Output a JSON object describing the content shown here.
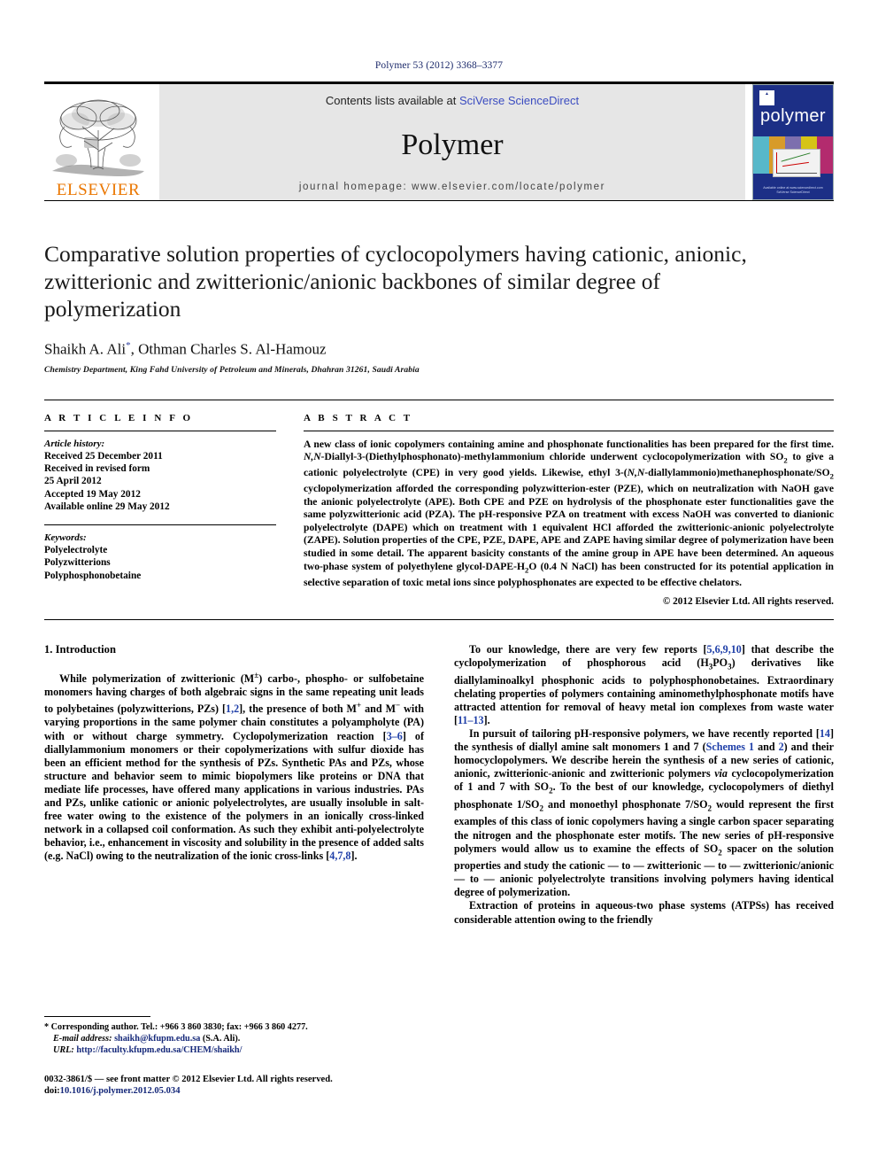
{
  "running_head": "Polymer 53 (2012) 3368–3377",
  "masthead": {
    "publisher_name": "ELSEVIER",
    "contents_prefix": "Contents lists available at ",
    "contents_link": "SciVerse ScienceDirect",
    "journal_name": "Polymer",
    "homepage": "journal homepage: www.elsevier.com/locate/polymer",
    "cover": {
      "title": "polymer",
      "footer_line1": "Available online at www.sciencedirect.com",
      "footer_line2": "SciVerse ScienceDirect"
    }
  },
  "article": {
    "title": "Comparative solution properties of cyclocopolymers having cationic, anionic, zwitterionic and zwitterionic/anionic backbones of similar degree of polymerization",
    "authors": "Shaikh A. Ali*, Othman Charles S. Al-Hamouz",
    "author_marker": "*",
    "affiliation": "Chemistry Department, King Fahd University of Petroleum and Minerals, Dhahran 31261, Saudi Arabia"
  },
  "article_info": {
    "heading": "A R T I C L E  I N F O",
    "history_label": "Article history:",
    "history": [
      "Received 25 December 2011",
      "Received in revised form",
      "25 April 2012",
      "Accepted 19 May 2012",
      "Available online 29 May 2012"
    ],
    "keywords_label": "Keywords:",
    "keywords": [
      "Polyelectrolyte",
      "Polyzwitterions",
      "Polyphosphonobetaine"
    ]
  },
  "abstract": {
    "heading": "A B S T R A C T",
    "text": "A new class of ionic copolymers containing amine and phosphonate functionalities has been prepared for the first time. N,N-Diallyl-3-(Diethylphosphonato)-methylammonium chloride underwent cyclocopolymerization with SO2 to give a cationic polyelectrolyte (CPE) in very good yields. Likewise, ethyl 3-(N,N-diallylammonio)methanephosphonate/SO2 cyclopolymerization afforded the corresponding polyzwitterion-ester (PZE), which on neutralization with NaOH gave the anionic polyelectrolyte (APE). Both CPE and PZE on hydrolysis of the phosphonate ester functionalities gave the same polyzwitterionic acid (PZA). The pH-responsive PZA on treatment with excess NaOH was converted to dianionic polyelectrolyte (DAPE) which on treatment with 1 equivalent HCl afforded the zwitterionic-anionic polyelectrolyte (ZAPE). Solution properties of the CPE, PZE, DAPE, APE and ZAPE having similar degree of polymerization have been studied in some detail. The apparent basicity constants of the amine group in APE have been determined. An aqueous two-phase system of polyethylene glycol-DAPE-H2O (0.4 N NaCl) has been constructed for its potential application in selective separation of toxic metal ions since polyphosphonates are expected to be effective chelators.",
    "copyright": "© 2012 Elsevier Ltd. All rights reserved."
  },
  "body": {
    "section_heading": "1. Introduction",
    "left_paragraphs": [
      "While polymerization of zwitterionic (M±) carbo-, phospho- or sulfobetaine monomers having charges of both algebraic signs in the same repeating unit leads to polybetaines (polyzwitterions, PZs) [1,2], the presence of both M+ and M− with varying proportions in the same polymer chain constitutes a polyampholyte (PA) with or without charge symmetry. Cyclopolymerization reaction [3–6] of diallylammonium monomers or their copolymerizations with sulfur dioxide has been an efficient method for the synthesis of PZs. Synthetic PAs and PZs, whose structure and behavior seem to mimic biopolymers like proteins or DNA that mediate life processes, have offered many applications in various industries. PAs and PZs, unlike cationic or anionic polyelectrolytes, are usually insoluble in salt-free water owing to the existence of the polymers in an ionically cross-linked network in a collapsed coil conformation. As such they exhibit anti-polyelectrolyte behavior, i.e., enhancement in viscosity and solubility in the presence of added salts (e.g. NaCl) owing to the neutralization of the ionic cross-links [4,7,8]."
    ],
    "right_paragraphs": [
      "To our knowledge, there are very few reports [5,6,9,10] that describe the cyclopolymerization of phosphorous acid (H3PO3) derivatives like diallylaminoalkyl phosphonic acids to polyphosphonobetaines. Extraordinary chelating properties of polymers containing aminomethylphosphonate motifs have attracted attention for removal of heavy metal ion complexes from waste water [11–13].",
      "In pursuit of tailoring pH-responsive polymers, we have recently reported [14] the synthesis of diallyl amine salt monomers 1 and 7 (Schemes 1 and 2) and their homocyclopolymers. We describe herein the synthesis of a new series of cationic, anionic, zwitterionic-anionic and zwitterionic polymers via cyclocopolymerization of 1 and 7 with SO2. To the best of our knowledge, cyclocopolymers of diethyl phosphonate 1/SO2 and monoethyl phosphonate 7/SO2 would represent the first examples of this class of ionic copolymers having a single carbon spacer separating the nitrogen and the phosphonate ester motifs. The new series of pH-responsive polymers would allow us to examine the effects of SO2 spacer on the solution properties and study the cationic — to — zwitterionic — to — zwitterionic/anionic — to — anionic polyelectrolyte transitions involving polymers having identical degree of polymerization.",
      "Extraction of proteins in aqueous-two phase systems (ATPSs) has received considerable attention owing to the friendly"
    ]
  },
  "footnote": {
    "marker": "*",
    "corresponding": "Corresponding author. Tel.: +966 3 860 3830; fax: +966 3 860 4277.",
    "email_label": "E-mail address:",
    "email": "shaikh@kfupm.edu.sa",
    "email_suffix": "(S.A. Ali).",
    "url_label": "URL:",
    "url": "http://faculty.kfupm.edu.sa/CHEM/shaikh/"
  },
  "imprint": {
    "line1": "0032-3861/$ — see front matter © 2012 Elsevier Ltd. All rights reserved.",
    "doi_label": "doi:",
    "doi": "10.1016/j.polymer.2012.05.034"
  },
  "colors": {
    "link": "#1f3fa8",
    "elsevier_orange": "#ea7600",
    "banner_gray": "#e6e6e6",
    "cover_blue": "#1c2f86",
    "running_head": "#1c2a6b"
  }
}
